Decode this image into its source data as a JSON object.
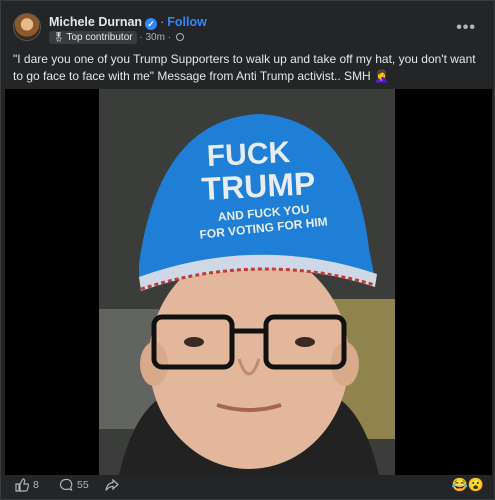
{
  "post": {
    "author": "Michele Durnan",
    "follow": "Follow",
    "badge": "Top contributor",
    "time": "30m",
    "separator": "·",
    "text": "\"I dare you one of you Trump Supporters to walk up and take off my hat, you don't want to go face to face with me\"  Message from Anti Trump activist..  SMH 🤦‍♀️",
    "more": "•••"
  },
  "image": {
    "hat_line1": "FUCK",
    "hat_line2": "TRUMP",
    "hat_line3": "AND FUCK YOU",
    "hat_line4": "FOR VOTING FOR HIM"
  },
  "footer": {
    "likes": "8",
    "comments": "55",
    "reaction_emojis": "😂😮"
  },
  "colors": {
    "accent": "#2d88ff",
    "hat": "#1f7fd6"
  }
}
